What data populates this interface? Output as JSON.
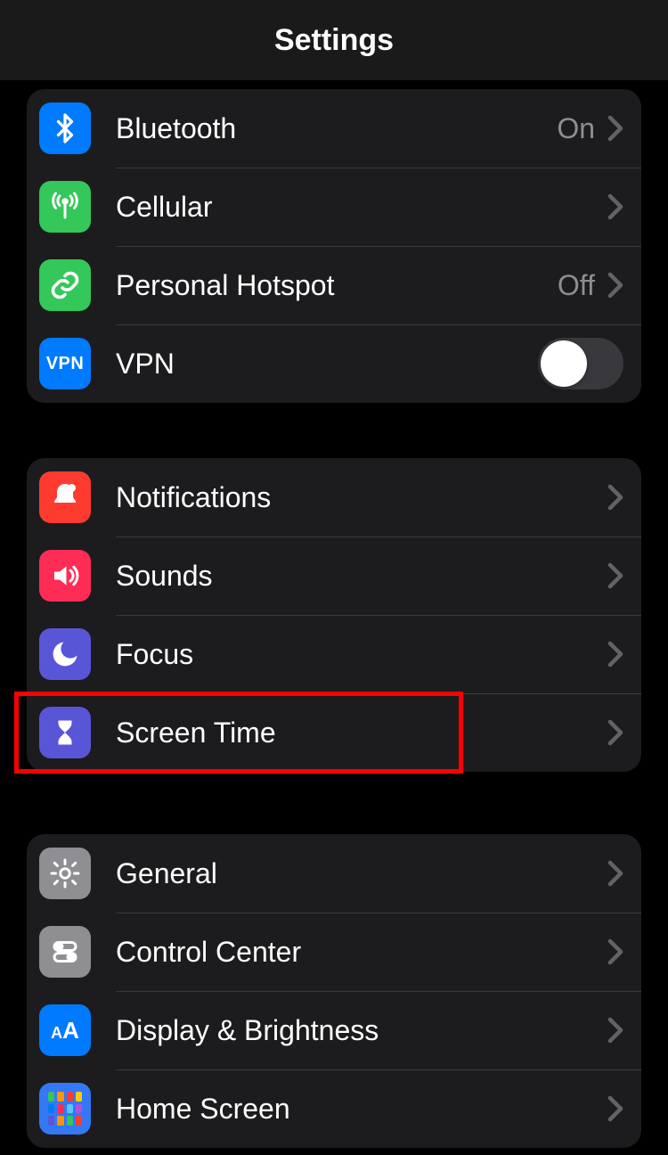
{
  "header": {
    "title": "Settings"
  },
  "groups": [
    {
      "rows": [
        {
          "id": "bluetooth",
          "label": "Bluetooth",
          "value": "On",
          "chevron": true,
          "icon_bg": "bg-blue"
        },
        {
          "id": "cellular",
          "label": "Cellular",
          "chevron": true,
          "icon_bg": "bg-green"
        },
        {
          "id": "hotspot",
          "label": "Personal Hotspot",
          "value": "Off",
          "chevron": true,
          "icon_bg": "bg-green"
        },
        {
          "id": "vpn",
          "label": "VPN",
          "toggle": true,
          "toggle_on": false,
          "icon_bg": "bg-blue"
        }
      ]
    },
    {
      "rows": [
        {
          "id": "notifications",
          "label": "Notifications",
          "chevron": true,
          "icon_bg": "bg-red"
        },
        {
          "id": "sounds",
          "label": "Sounds",
          "chevron": true,
          "icon_bg": "bg-pink"
        },
        {
          "id": "focus",
          "label": "Focus",
          "chevron": true,
          "icon_bg": "bg-indigo"
        },
        {
          "id": "screentime",
          "label": "Screen Time",
          "chevron": true,
          "icon_bg": "bg-indigo",
          "highlight": true
        }
      ]
    },
    {
      "rows": [
        {
          "id": "general",
          "label": "General",
          "chevron": true,
          "icon_bg": "bg-gray"
        },
        {
          "id": "controlcenter",
          "label": "Control Center",
          "chevron": true,
          "icon_bg": "bg-gray"
        },
        {
          "id": "display",
          "label": "Display & Brightness",
          "chevron": true,
          "icon_bg": "bg-blue"
        },
        {
          "id": "homescreen",
          "label": "Home Screen",
          "chevron": true,
          "icon_bg": "bg-darkblue"
        }
      ]
    }
  ],
  "icons": {
    "bluetooth": "bluetooth-icon",
    "cellular": "cellular-antenna-icon",
    "hotspot": "link-icon",
    "vpn": "vpn-text-icon",
    "notifications": "bell-icon",
    "sounds": "speaker-icon",
    "focus": "moon-icon",
    "screentime": "hourglass-icon",
    "general": "gear-icon",
    "controlcenter": "switches-icon",
    "display": "text-aa-icon",
    "homescreen": "app-grid-icon"
  },
  "home_grid_colors": [
    "#34c759",
    "#ff9500",
    "#ff3b30",
    "#ffcc00",
    "#007aff",
    "#ff2d55",
    "#5ac8fa",
    "#af52de",
    "#5856d6",
    "#ff9500",
    "#34c759",
    "#ff3b30"
  ]
}
